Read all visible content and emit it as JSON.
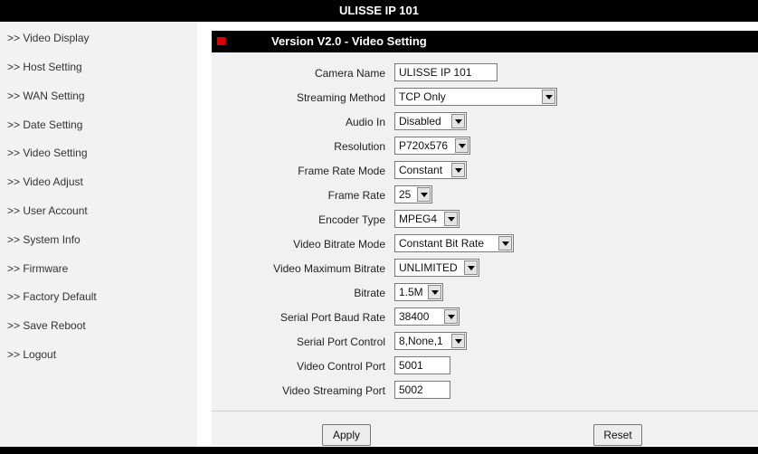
{
  "header": {
    "title": "ULISSE IP 101"
  },
  "sidebar": {
    "items": [
      {
        "label": ">> Video Display"
      },
      {
        "label": ">> Host Setting"
      },
      {
        "label": ">> WAN Setting"
      },
      {
        "label": ">> Date Setting"
      },
      {
        "label": ">> Video Setting"
      },
      {
        "label": ">> Video Adjust"
      },
      {
        "label": ">> User Account"
      },
      {
        "label": ">> System Info"
      },
      {
        "label": ">> Firmware"
      },
      {
        "label": ">> Factory Default"
      },
      {
        "label": ">> Save Reboot"
      },
      {
        "label": ">> Logout"
      }
    ]
  },
  "panel": {
    "title": "Version V2.0 - Video Setting"
  },
  "form": {
    "camera_name": {
      "label": "Camera Name",
      "value": "ULISSE IP 101"
    },
    "streaming_method": {
      "label": "Streaming Method",
      "value": "TCP Only"
    },
    "audio_in": {
      "label": "Audio In",
      "value": "Disabled"
    },
    "resolution": {
      "label": "Resolution",
      "value": "P720x576"
    },
    "frame_rate_mode": {
      "label": "Frame Rate Mode",
      "value": "Constant"
    },
    "frame_rate": {
      "label": "Frame Rate",
      "value": "25"
    },
    "encoder_type": {
      "label": "Encoder Type",
      "value": "MPEG4"
    },
    "video_bitrate_mode": {
      "label": "Video Bitrate Mode",
      "value": "Constant Bit Rate"
    },
    "video_max_bitrate": {
      "label": "Video Maximum Bitrate",
      "value": "UNLIMITED"
    },
    "bitrate": {
      "label": "Bitrate",
      "value": "1.5M"
    },
    "serial_baud": {
      "label": "Serial Port Baud Rate",
      "value": "38400"
    },
    "serial_control": {
      "label": "Serial Port Control",
      "value": "8,None,1"
    },
    "video_control_port": {
      "label": "Video Control Port",
      "value": "5001"
    },
    "video_streaming_port": {
      "label": "Video Streaming Port",
      "value": "5002"
    }
  },
  "buttons": {
    "apply": "Apply",
    "reset": "Reset"
  }
}
